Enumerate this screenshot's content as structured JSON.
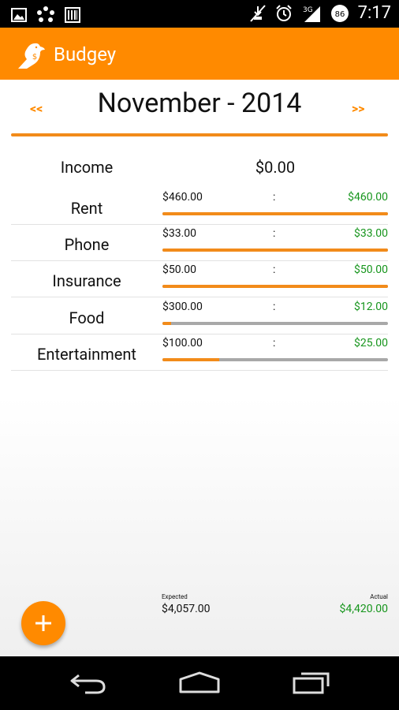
{
  "status_bar": {
    "time": "7:17",
    "battery": "86",
    "network": "3G",
    "icons": [
      "image-icon",
      "dots-icon",
      "barcode-icon",
      "muted-icon",
      "alarm-icon",
      "signal-icon",
      "battery-icon"
    ]
  },
  "app_bar": {
    "title": "Budgey",
    "logo_icon": "bird-logo-icon",
    "logo_badge": "$"
  },
  "month_nav": {
    "prev_label": "<<",
    "title": "November - 2014",
    "next_label": ">>"
  },
  "income": {
    "label": "Income",
    "value": "$0.00"
  },
  "categories": [
    {
      "name": "Rent",
      "expected": "$460.00",
      "separator": ":",
      "actual": "$460.00",
      "progress": 1.0
    },
    {
      "name": "Phone",
      "expected": "$33.00",
      "separator": ":",
      "actual": "$33.00",
      "progress": 1.0
    },
    {
      "name": "Insurance",
      "expected": "$50.00",
      "separator": ":",
      "actual": "$50.00",
      "progress": 1.0
    },
    {
      "name": "Food",
      "expected": "$300.00",
      "separator": ":",
      "actual": "$12.00",
      "progress": 0.04
    },
    {
      "name": "Entertainment",
      "expected": "$100.00",
      "separator": ":",
      "actual": "$25.00",
      "progress": 0.25
    }
  ],
  "summary": {
    "expected_label": "Expected",
    "expected_value": "$4,057.00",
    "actual_label": "Actual",
    "actual_value": "$4,420.00"
  },
  "fab": {
    "icon": "plus-icon"
  },
  "nav_bar": {
    "icons": [
      "back-icon",
      "home-icon",
      "recents-icon"
    ]
  },
  "colors": {
    "accent": "#ff8a00",
    "progress": "#f28b1a",
    "track": "#a8a8a8",
    "positive": "#16951c",
    "status_bar": "#000000"
  }
}
